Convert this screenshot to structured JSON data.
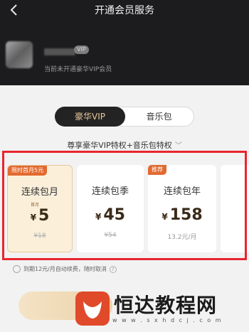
{
  "header": {
    "back_icon": "chevron-left-icon",
    "title": "开通会员服务",
    "vip_badge": "VIP",
    "status_text": "当前未开通豪华VIP会员"
  },
  "tabs": [
    {
      "label": "豪华VIP",
      "active": true
    },
    {
      "label": "音乐包",
      "active": false
    }
  ],
  "benefits": {
    "text": "尊享豪华VIP特权+音乐包特权",
    "chevron_icon": "chevron-down-icon"
  },
  "plans": [
    {
      "tag": "限时首月5元",
      "name": "连续包月",
      "note": "首月",
      "currency": "¥",
      "price": "5",
      "original": "¥18",
      "selected": true
    },
    {
      "tag": "",
      "name": "连续包季",
      "note": "",
      "currency": "¥",
      "price": "45",
      "original": "¥54",
      "selected": false
    },
    {
      "tag": "推荐",
      "name": "连续包年",
      "note": "",
      "currency": "¥",
      "price": "158",
      "per_month": "13.2元/月",
      "selected": false
    }
  ],
  "auto_renew": {
    "text": "到期12元/月自动续费，随时取消",
    "help_icon": "question-icon"
  },
  "watermark": {
    "brand": "恒达教程网",
    "url": "w w w . s x h d c j . c o m"
  },
  "colors": {
    "accent_gold": "#e9c99c",
    "highlight_red": "#e8252f",
    "tag_orange": "#e26a30"
  }
}
